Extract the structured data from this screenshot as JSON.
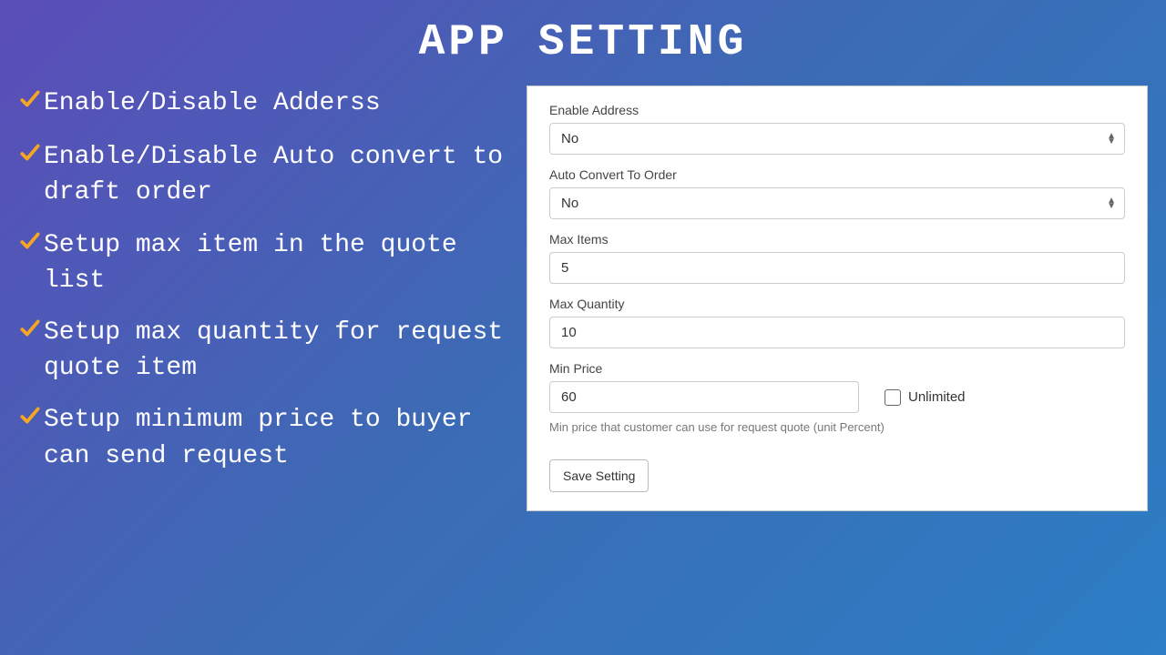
{
  "title": "APP SETTING",
  "features": [
    "Enable/Disable Adderss",
    "Enable/Disable Auto convert to draft order",
    "Setup max item in the quote list",
    "Setup max quantity for request quote item",
    "Setup minimum price to buyer can send request"
  ],
  "form": {
    "enable_address": {
      "label": "Enable Address",
      "value": "No"
    },
    "auto_convert": {
      "label": "Auto Convert To Order",
      "value": "No"
    },
    "max_items": {
      "label": "Max Items",
      "value": "5"
    },
    "max_quantity": {
      "label": "Max Quantity",
      "value": "10"
    },
    "min_price": {
      "label": "Min Price",
      "value": "60",
      "unlimited_label": "Unlimited",
      "helper": "Min price that customer can use for request quote (unit Percent)"
    },
    "save_label": "Save Setting"
  }
}
